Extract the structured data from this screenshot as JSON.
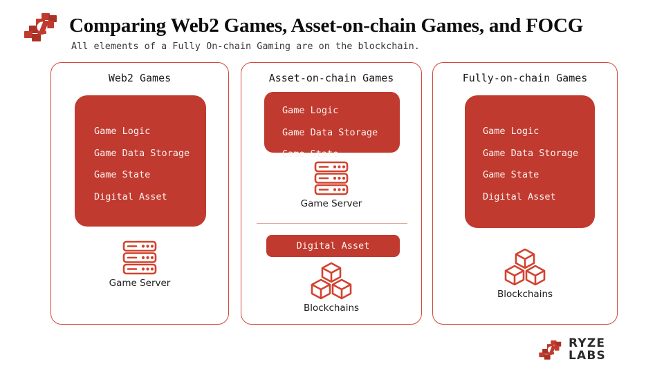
{
  "header": {
    "title": "Comparing Web2 Games, Asset-on-chain Games, and FOCG",
    "subtitle": "All elements of a Fully On-chain Gaming are on the blockchain.",
    "logo_icon": "ryze-blocks-mark"
  },
  "colors": {
    "brand_red": "#C03A2F",
    "border_red": "#D4473B",
    "icon_red": "#D1432F",
    "divider_red": "#E8A79F",
    "background": "#FFFFFF",
    "title_text": "#0D0D0D"
  },
  "columns": [
    {
      "id": "web2-games",
      "title": "Web2 Games",
      "block_items": [
        "Game Logic",
        "Game Data Storage",
        "Game State",
        "Digital Asset"
      ],
      "icons": [
        {
          "type": "server",
          "icon_name": "server-stack-icon",
          "caption": "Game Server"
        }
      ]
    },
    {
      "id": "asset-on-chain-games",
      "title": "Asset-on-chain Games",
      "block_items": [
        "Game Logic",
        "Game Data Storage",
        "Game State"
      ],
      "pill_label": "Digital Asset",
      "icons": [
        {
          "type": "server",
          "icon_name": "server-stack-icon",
          "caption": "Game Server"
        },
        {
          "type": "chain",
          "icon_name": "blockchain-cubes-icon",
          "caption": "Blockchains"
        }
      ]
    },
    {
      "id": "fully-on-chain-games",
      "title": "Fully-on-chain Games",
      "block_items": [
        "Game Logic",
        "Game Data Storage",
        "Game State",
        "Digital Asset"
      ],
      "icons": [
        {
          "type": "chain",
          "icon_name": "blockchain-cubes-icon",
          "caption": "Blockchains"
        }
      ]
    }
  ],
  "footer": {
    "logo_icon": "ryze-blocks-mark",
    "line1": "RYZE",
    "line2": "LABS"
  }
}
